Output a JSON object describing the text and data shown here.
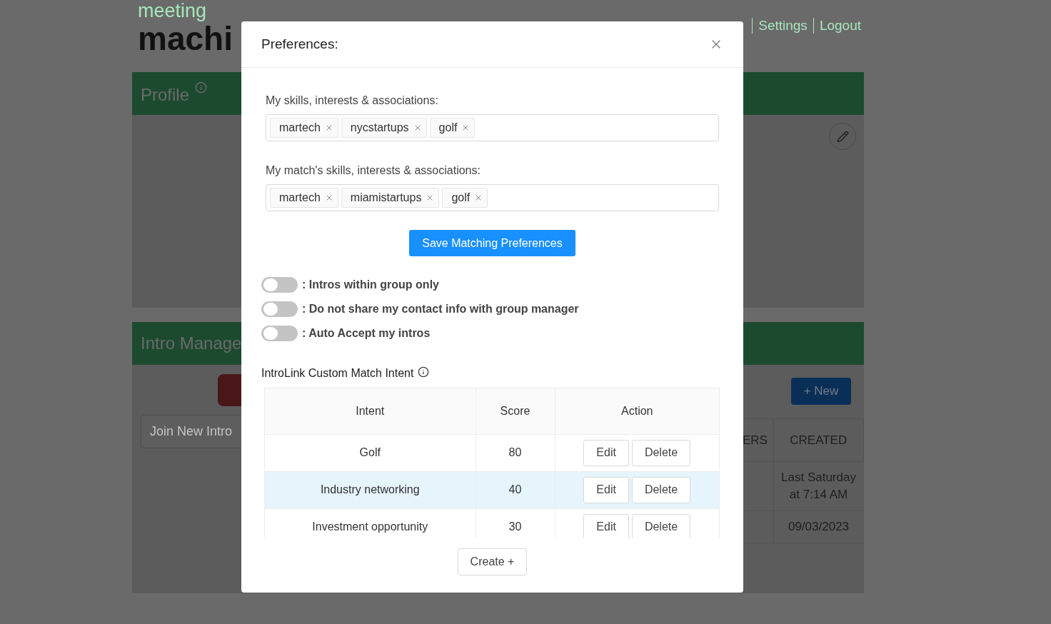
{
  "logo": {
    "top": "meeting",
    "bottom": "machi"
  },
  "nav": [
    {
      "label": "Settings"
    },
    {
      "label": "Logout"
    }
  ],
  "profile_card": {
    "title": "Profile"
  },
  "intro_card": {
    "title": "Intro Manage",
    "join_field": {
      "placeholder": "Join New Intro"
    },
    "new_button": "+ New",
    "table": {
      "columns": [
        "ERS",
        "CREATED"
      ],
      "rows": [
        {
          "created": "Last Saturday at 7:14 AM"
        },
        {
          "created": "09/03/2023"
        }
      ]
    }
  },
  "modal": {
    "title": "Preferences:",
    "tag_fields": [
      {
        "label": "My skills, interests & associations:",
        "tags": [
          "martech",
          "nycstartups",
          "golf"
        ]
      },
      {
        "label": "My match's skills, interests & associations:",
        "tags": [
          "martech",
          "miamistartups",
          "golf"
        ]
      }
    ],
    "save_button": "Save Matching Preferences",
    "toggles": [
      {
        "label": ": Intros within group only",
        "on": false
      },
      {
        "label": ": Do not share my contact info with group manager",
        "on": false
      },
      {
        "label": ": Auto Accept my intros",
        "on": false
      }
    ],
    "intent_section": {
      "title": "IntroLink Custom Match Intent",
      "columns": [
        "Intent",
        "Score",
        "Action"
      ],
      "rows": [
        {
          "intent": "Golf",
          "score": "80",
          "selected": false,
          "actions": [
            "Edit",
            "Delete"
          ]
        },
        {
          "intent": "Industry networking",
          "score": "40",
          "selected": true,
          "actions": [
            "Edit",
            "Delete"
          ]
        },
        {
          "intent": "Investment opportunity",
          "score": "30",
          "selected": false,
          "actions": [
            "Edit",
            "Delete"
          ]
        }
      ],
      "create_button": "Create +"
    }
  }
}
